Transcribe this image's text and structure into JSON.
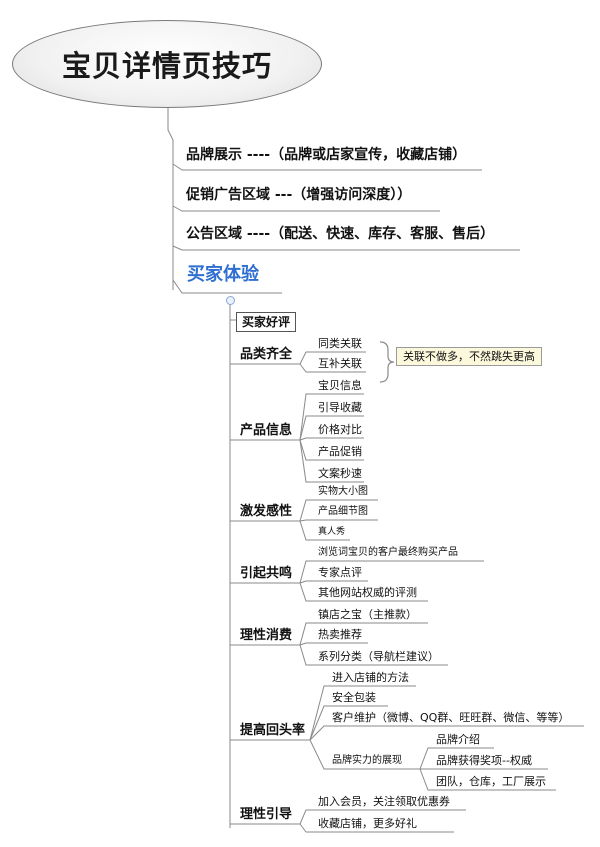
{
  "title": "宝贝详情页技巧",
  "level1": [
    {
      "label": "品牌展示 ----（品牌或店家宣传，收藏店铺）"
    },
    {
      "label": "促销广告区域 ---（增强访问深度））"
    },
    {
      "label": "公告区域 ----（配送、快速、库存、客服、售后）"
    }
  ],
  "buyer": {
    "label": "买家体验",
    "good_review": "买家好评",
    "categories": [
      {
        "label": "品类齐全",
        "items": [
          "同类关联",
          "互补关联"
        ],
        "note": "关联不做多，不然跳失更高"
      },
      {
        "label": "产品信息",
        "items": [
          "宝贝信息",
          "引导收藏",
          "价格对比",
          "产品促销",
          "文案秒速"
        ]
      },
      {
        "label": "激发感性",
        "items": [
          "实物大小图",
          "产品细节图",
          "真人秀"
        ]
      },
      {
        "label": "引起共鸣",
        "items": [
          "浏览词宝贝的客户最终购买产品",
          "专家点评",
          "其他网站权威的评测"
        ]
      },
      {
        "label": "理性消费",
        "items": [
          "镇店之宝（主推款）",
          "热卖推荐",
          "系列分类（导航栏建议）"
        ]
      },
      {
        "label": "提高回头率",
        "items": [
          "进入店铺的方法",
          "安全包装",
          "客户维护（微博、QQ群、旺旺群、微信、等等）",
          "品牌实力的展现"
        ],
        "sub": [
          "品牌介绍",
          "品牌获得奖项--权威",
          "团队，仓库，工厂展示"
        ]
      },
      {
        "label": "理性引导",
        "items": [
          "加入会员，关注领取优惠券",
          "收藏店铺，更多好礼"
        ]
      }
    ]
  }
}
